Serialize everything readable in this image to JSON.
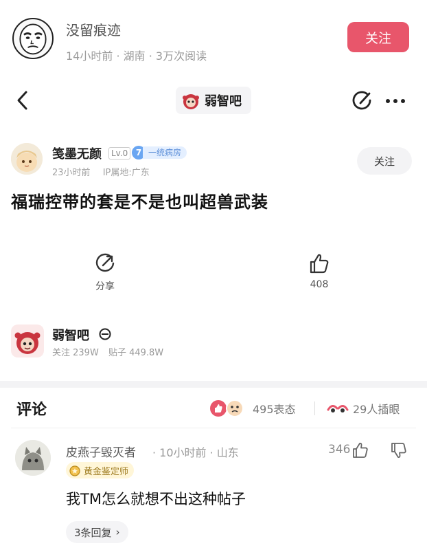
{
  "outer_post": {
    "username": "没留痕迹",
    "time": "14小时前",
    "location": "湖南",
    "views": "3万次阅读",
    "follow_label": "关注"
  },
  "topbar": {
    "forum_name": "弱智吧"
  },
  "post": {
    "author": "笺墨无颜",
    "level": "Lv.0",
    "rank_number": "7",
    "rank_label": "一统病房",
    "time": "23小时前",
    "ip": "IP属地:广东",
    "follow_label": "关注",
    "title": "福瑞控带的套是不是也叫超兽武装",
    "share_label": "分享",
    "like_count": "408"
  },
  "forum_card": {
    "name": "弱智吧",
    "followers": "关注 239W",
    "posts": "贴子 449.8W"
  },
  "comments": {
    "title": "评论",
    "reactions": "495表态",
    "inserts": "29人插眼",
    "items": [
      {
        "user": "皮燕子毁灭者",
        "meta": "· 10小时前 · 山东",
        "badge": "黄金鉴定师",
        "likes": "346",
        "text": "我TM怎么就想不出这种帖子",
        "replies": "3条回复",
        "replies_arrow": "›"
      }
    ]
  },
  "colors": {
    "follow_red": "#e8566b",
    "rank_blue": "#6aa6f2",
    "badge_gold": "#9d7a1e"
  }
}
